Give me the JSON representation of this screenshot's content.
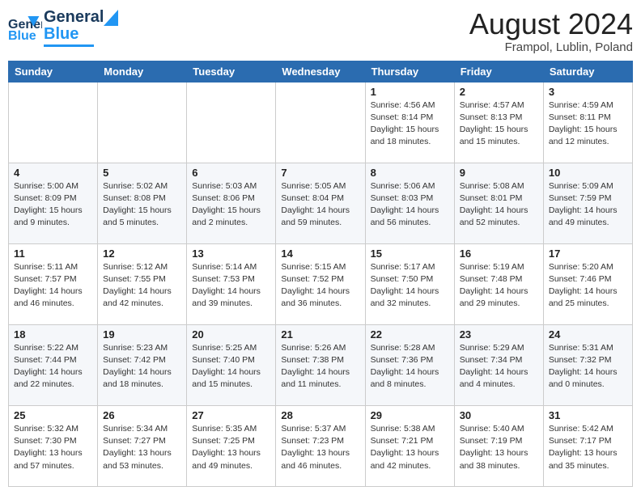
{
  "header": {
    "logo_general": "General",
    "logo_blue": "Blue",
    "month_title": "August 2024",
    "location": "Frampol, Lublin, Poland"
  },
  "days_of_week": [
    "Sunday",
    "Monday",
    "Tuesday",
    "Wednesday",
    "Thursday",
    "Friday",
    "Saturday"
  ],
  "weeks": [
    [
      {
        "day": "",
        "info": ""
      },
      {
        "day": "",
        "info": ""
      },
      {
        "day": "",
        "info": ""
      },
      {
        "day": "",
        "info": ""
      },
      {
        "day": "1",
        "info": "Sunrise: 4:56 AM\nSunset: 8:14 PM\nDaylight: 15 hours\nand 18 minutes."
      },
      {
        "day": "2",
        "info": "Sunrise: 4:57 AM\nSunset: 8:13 PM\nDaylight: 15 hours\nand 15 minutes."
      },
      {
        "day": "3",
        "info": "Sunrise: 4:59 AM\nSunset: 8:11 PM\nDaylight: 15 hours\nand 12 minutes."
      }
    ],
    [
      {
        "day": "4",
        "info": "Sunrise: 5:00 AM\nSunset: 8:09 PM\nDaylight: 15 hours\nand 9 minutes."
      },
      {
        "day": "5",
        "info": "Sunrise: 5:02 AM\nSunset: 8:08 PM\nDaylight: 15 hours\nand 5 minutes."
      },
      {
        "day": "6",
        "info": "Sunrise: 5:03 AM\nSunset: 8:06 PM\nDaylight: 15 hours\nand 2 minutes."
      },
      {
        "day": "7",
        "info": "Sunrise: 5:05 AM\nSunset: 8:04 PM\nDaylight: 14 hours\nand 59 minutes."
      },
      {
        "day": "8",
        "info": "Sunrise: 5:06 AM\nSunset: 8:03 PM\nDaylight: 14 hours\nand 56 minutes."
      },
      {
        "day": "9",
        "info": "Sunrise: 5:08 AM\nSunset: 8:01 PM\nDaylight: 14 hours\nand 52 minutes."
      },
      {
        "day": "10",
        "info": "Sunrise: 5:09 AM\nSunset: 7:59 PM\nDaylight: 14 hours\nand 49 minutes."
      }
    ],
    [
      {
        "day": "11",
        "info": "Sunrise: 5:11 AM\nSunset: 7:57 PM\nDaylight: 14 hours\nand 46 minutes."
      },
      {
        "day": "12",
        "info": "Sunrise: 5:12 AM\nSunset: 7:55 PM\nDaylight: 14 hours\nand 42 minutes."
      },
      {
        "day": "13",
        "info": "Sunrise: 5:14 AM\nSunset: 7:53 PM\nDaylight: 14 hours\nand 39 minutes."
      },
      {
        "day": "14",
        "info": "Sunrise: 5:15 AM\nSunset: 7:52 PM\nDaylight: 14 hours\nand 36 minutes."
      },
      {
        "day": "15",
        "info": "Sunrise: 5:17 AM\nSunset: 7:50 PM\nDaylight: 14 hours\nand 32 minutes."
      },
      {
        "day": "16",
        "info": "Sunrise: 5:19 AM\nSunset: 7:48 PM\nDaylight: 14 hours\nand 29 minutes."
      },
      {
        "day": "17",
        "info": "Sunrise: 5:20 AM\nSunset: 7:46 PM\nDaylight: 14 hours\nand 25 minutes."
      }
    ],
    [
      {
        "day": "18",
        "info": "Sunrise: 5:22 AM\nSunset: 7:44 PM\nDaylight: 14 hours\nand 22 minutes."
      },
      {
        "day": "19",
        "info": "Sunrise: 5:23 AM\nSunset: 7:42 PM\nDaylight: 14 hours\nand 18 minutes."
      },
      {
        "day": "20",
        "info": "Sunrise: 5:25 AM\nSunset: 7:40 PM\nDaylight: 14 hours\nand 15 minutes."
      },
      {
        "day": "21",
        "info": "Sunrise: 5:26 AM\nSunset: 7:38 PM\nDaylight: 14 hours\nand 11 minutes."
      },
      {
        "day": "22",
        "info": "Sunrise: 5:28 AM\nSunset: 7:36 PM\nDaylight: 14 hours\nand 8 minutes."
      },
      {
        "day": "23",
        "info": "Sunrise: 5:29 AM\nSunset: 7:34 PM\nDaylight: 14 hours\nand 4 minutes."
      },
      {
        "day": "24",
        "info": "Sunrise: 5:31 AM\nSunset: 7:32 PM\nDaylight: 14 hours\nand 0 minutes."
      }
    ],
    [
      {
        "day": "25",
        "info": "Sunrise: 5:32 AM\nSunset: 7:30 PM\nDaylight: 13 hours\nand 57 minutes."
      },
      {
        "day": "26",
        "info": "Sunrise: 5:34 AM\nSunset: 7:27 PM\nDaylight: 13 hours\nand 53 minutes."
      },
      {
        "day": "27",
        "info": "Sunrise: 5:35 AM\nSunset: 7:25 PM\nDaylight: 13 hours\nand 49 minutes."
      },
      {
        "day": "28",
        "info": "Sunrise: 5:37 AM\nSunset: 7:23 PM\nDaylight: 13 hours\nand 46 minutes."
      },
      {
        "day": "29",
        "info": "Sunrise: 5:38 AM\nSunset: 7:21 PM\nDaylight: 13 hours\nand 42 minutes."
      },
      {
        "day": "30",
        "info": "Sunrise: 5:40 AM\nSunset: 7:19 PM\nDaylight: 13 hours\nand 38 minutes."
      },
      {
        "day": "31",
        "info": "Sunrise: 5:42 AM\nSunset: 7:17 PM\nDaylight: 13 hours\nand 35 minutes."
      }
    ]
  ]
}
